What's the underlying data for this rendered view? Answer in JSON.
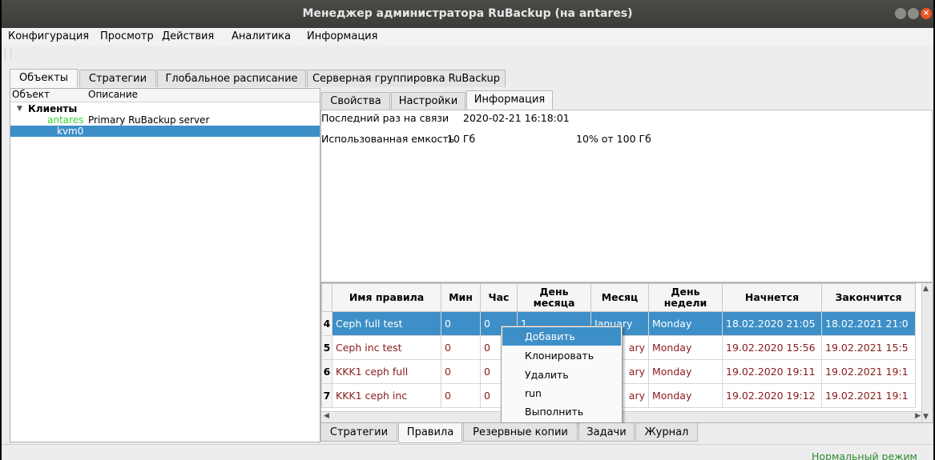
{
  "window": {
    "title": "Менеджер администратора RuBackup (на antares)"
  },
  "menu": [
    "Конфигурация",
    "Просмотр",
    "Действия",
    "Аналитика",
    "Информация"
  ],
  "main_tabs": [
    "Объекты",
    "Стратегии",
    "Глобальное расписание",
    "Серверная группировка RuBackup"
  ],
  "tree": {
    "columns": [
      "Объект",
      "Описание"
    ],
    "group": "Клиенты",
    "items": [
      {
        "name": "antares",
        "description": "Primary RuBackup server",
        "color": "#3cd23c"
      },
      {
        "name": "kvm0",
        "description": "",
        "selected": true
      }
    ]
  },
  "detail_tabs": [
    "Свойства",
    "Настройки",
    "Информация"
  ],
  "info": {
    "last_seen_label": "Последний раз на связи",
    "last_seen_value": "2020-02-21 16:18:01",
    "capacity_label": "Использованная емкость",
    "capacity_value": "10 Гб",
    "capacity_percent": "10% от 100 Гб"
  },
  "rules_table": {
    "headers": [
      "Имя правила",
      "Мин",
      "Час",
      "День месяца",
      "Месяц",
      "День недели",
      "Начнется",
      "Закончится"
    ],
    "rows": [
      {
        "num": "4",
        "name": "Ceph full test",
        "min": "0",
        "hour": "0",
        "day": "1",
        "month": "January",
        "weekday": "Monday",
        "start": "18.02.2020 21:05",
        "end": "18.02.2021 21:0",
        "selected": true
      },
      {
        "num": "5",
        "name": "Ceph inc test",
        "min": "0",
        "hour": "0",
        "day": "",
        "month": "ary",
        "weekday": "Monday",
        "start": "19.02.2020 15:56",
        "end": "19.02.2021 15:5"
      },
      {
        "num": "6",
        "name": "KKK1 ceph full",
        "min": "0",
        "hour": "0",
        "day": "",
        "month": "ary",
        "weekday": "Monday",
        "start": "19.02.2020 19:11",
        "end": "19.02.2021 19:1"
      },
      {
        "num": "7",
        "name": "KKK1 ceph inc",
        "min": "0",
        "hour": "0",
        "day": "",
        "month": "ary",
        "weekday": "Monday",
        "start": "19.02.2020 19:12",
        "end": "19.02.2021 19:1"
      }
    ]
  },
  "context_menu": [
    "Добавить",
    "Клонировать",
    "Удалить",
    "run",
    "Выполнить"
  ],
  "bottom_tabs": [
    "Стратегии",
    "Правила",
    "Резервные копии",
    "Задачи",
    "Журнал"
  ],
  "status": "Нормальный режим",
  "colors": {
    "selection": "#3d8fc7",
    "rule_text": "#8b1a1a",
    "status_text": "#2e8b2e"
  }
}
